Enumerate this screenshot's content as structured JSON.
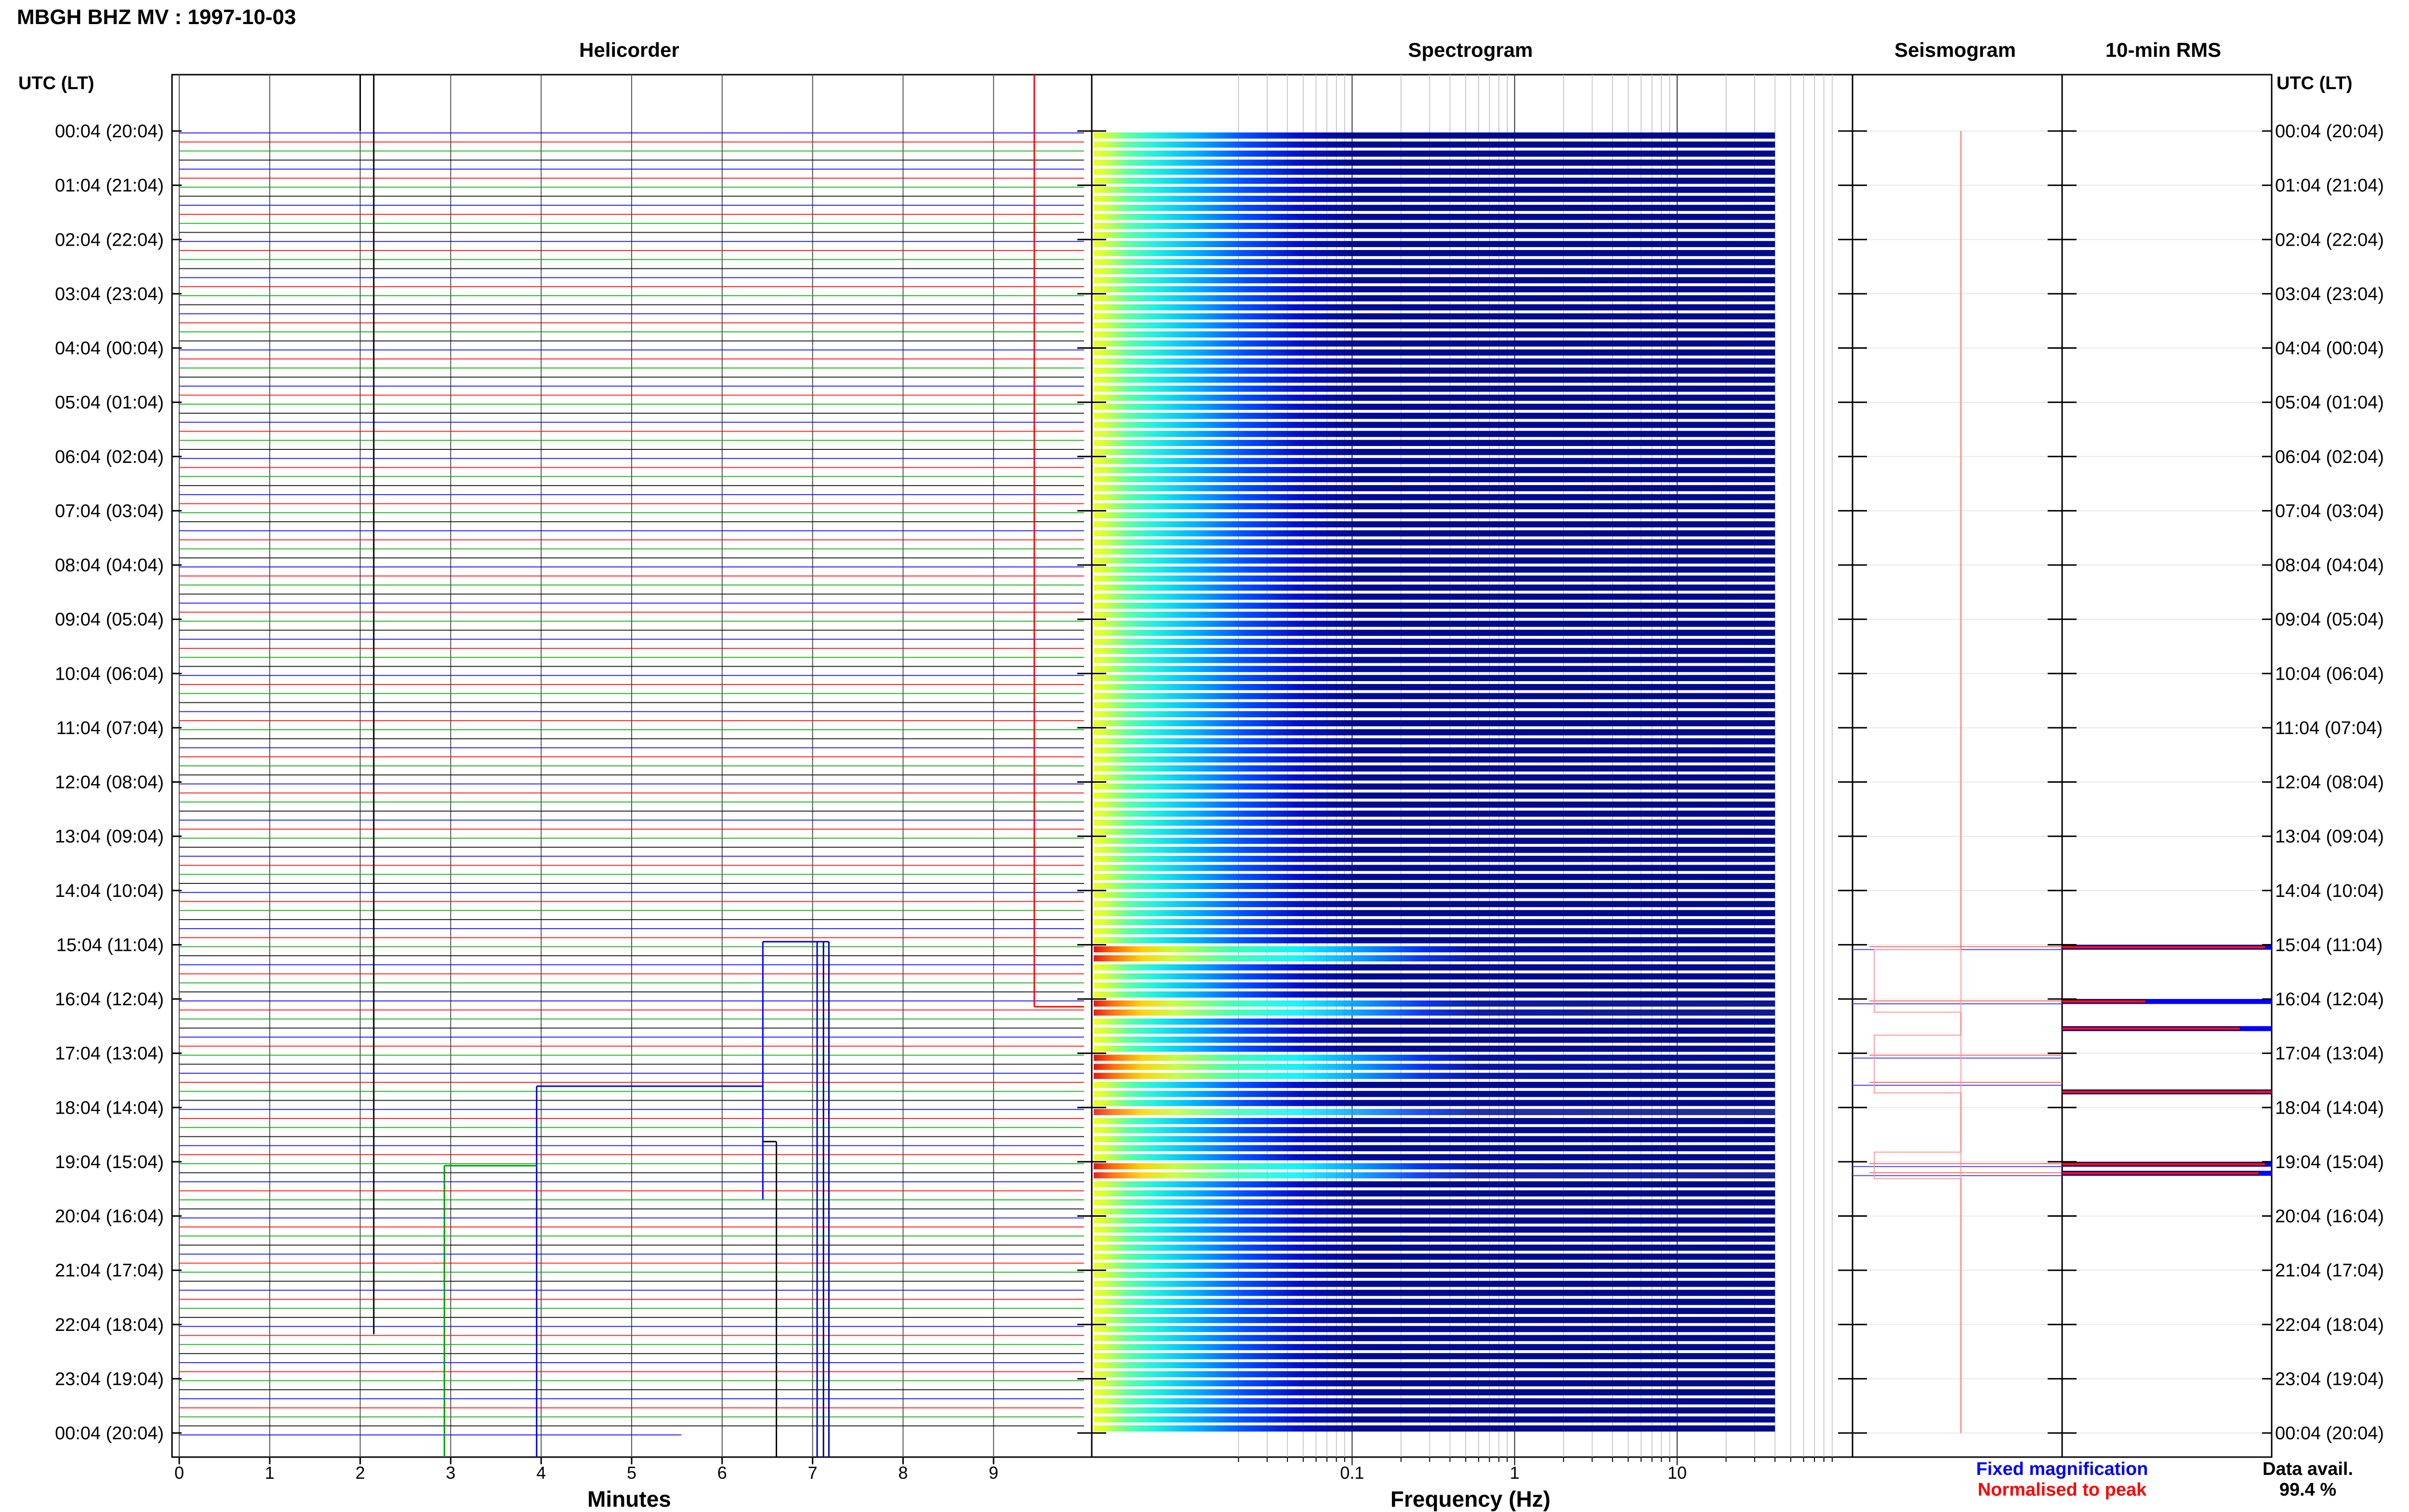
{
  "header": {
    "title": "MBGH BHZ MV : 1997-10-03",
    "utc_label": "UTC (LT)"
  },
  "panels": {
    "helicorder": "Helicorder",
    "spectrogram": "Spectrogram",
    "seismogram": "Seismogram",
    "rms": "10-min RMS"
  },
  "axes": {
    "minutes_label": "Minutes",
    "frequency_label": "Frequency (Hz)",
    "minute_ticks": [
      "0",
      "1",
      "2",
      "3",
      "4",
      "5",
      "6",
      "7",
      "8",
      "9"
    ],
    "frequency_ticks": [
      "0.1",
      "1",
      "10"
    ]
  },
  "hour_labels": [
    "00:04 (20:04)",
    "01:04 (21:04)",
    "02:04 (22:04)",
    "03:04 (23:04)",
    "04:04 (00:04)",
    "05:04 (01:04)",
    "06:04 (02:04)",
    "07:04 (03:04)",
    "08:04 (04:04)",
    "09:04 (05:04)",
    "10:04 (06:04)",
    "11:04 (07:04)",
    "12:04 (08:04)",
    "13:04 (09:04)",
    "14:04 (10:04)",
    "15:04 (11:04)",
    "16:04 (12:04)",
    "17:04 (13:04)",
    "18:04 (14:04)",
    "19:04 (15:04)",
    "20:04 (16:04)",
    "21:04 (17:04)",
    "22:04 (18:04)",
    "23:04 (19:04)",
    "00:04 (20:04)"
  ],
  "legend": {
    "fixed": "Fixed magnification",
    "normalised": "Normalised to peak",
    "fixed_color": "#0000ff",
    "normalised_color": "#ff0000"
  },
  "data_avail": {
    "label": "Data avail.",
    "value": "99.4 %"
  },
  "chart_data": {
    "type": "heatmap",
    "rows_per_hour": 6,
    "row_minutes": 10,
    "frequency_range_hz": [
      0.02,
      40
    ],
    "frequency_scale": "log",
    "trace_colors": [
      "#0000ff",
      "#ff0000",
      "#00aa00",
      "#000000"
    ],
    "event_rows": [
      {
        "hour": 15,
        "row": 0,
        "intensity": 1.0
      },
      {
        "hour": 15,
        "row": 1,
        "intensity": 0.85
      },
      {
        "hour": 16,
        "row": 0,
        "intensity": 0.8
      },
      {
        "hour": 16,
        "row": 1,
        "intensity": 0.75
      },
      {
        "hour": 17,
        "row": 0,
        "intensity": 0.95
      },
      {
        "hour": 17,
        "row": 1,
        "intensity": 0.9
      },
      {
        "hour": 17,
        "row": 2,
        "intensity": 0.85
      },
      {
        "hour": 18,
        "row": 0,
        "intensity": 0.45
      },
      {
        "hour": 19,
        "row": 0,
        "intensity": 0.9
      },
      {
        "hour": 19,
        "row": 1,
        "intensity": 0.65
      }
    ],
    "rms_bars": [
      {
        "hour": 15,
        "row": 0,
        "fixed": 1.0,
        "normalised": 0.97
      },
      {
        "hour": 16,
        "row": 0,
        "fixed": 1.0,
        "normalised": 0.4
      },
      {
        "hour": 16,
        "row": 3,
        "fixed": 1.0,
        "normalised": 0.85
      },
      {
        "hour": 17,
        "row": 4,
        "fixed": 1.0,
        "normalised": 1.0
      },
      {
        "hour": 19,
        "row": 0,
        "fixed": 1.0,
        "normalised": 0.97
      },
      {
        "hour": 19,
        "row": 1,
        "fixed": 1.0,
        "normalised": 0.94
      }
    ],
    "helicorder_spikes_minutes": [
      2.0,
      2.15,
      2.93,
      3.95,
      6.45,
      6.6,
      7.05,
      7.1,
      7.15,
      9.45
    ]
  }
}
